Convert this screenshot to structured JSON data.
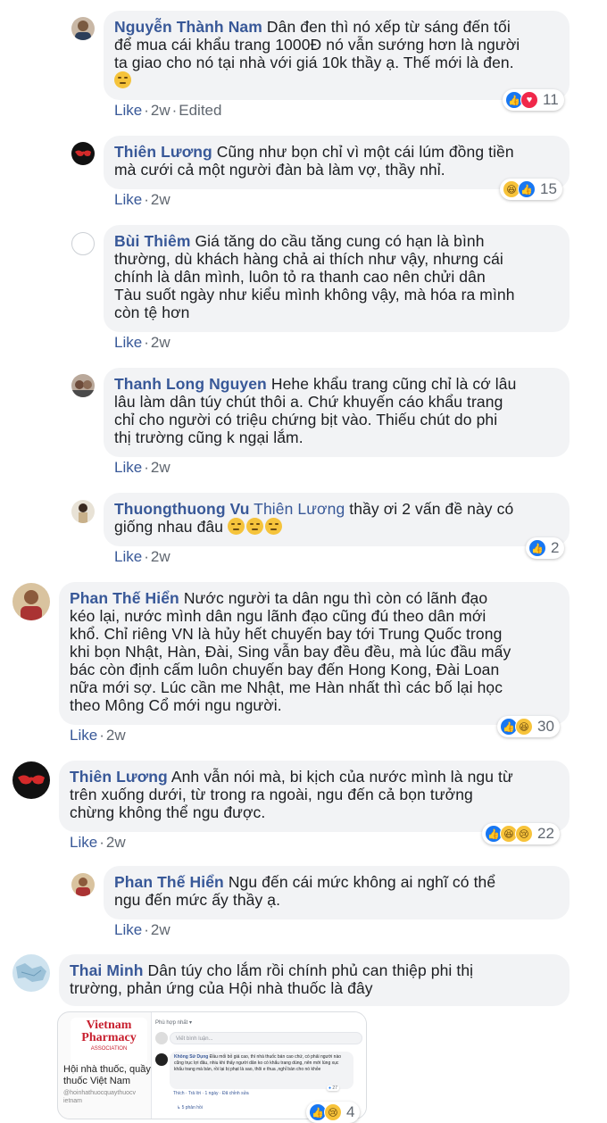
{
  "comments": [
    {
      "name": "Nguyễn Thành Nam",
      "text_lines": [
        "Dân đen thì nó xếp từ sáng đến tối",
        "để mua cái khẩu trang 1000Đ nó vẫn sướng hơn là người",
        "ta giao cho nó tại nhà với giá 10k thầy ạ. Thế mới là đen."
      ],
      "like": "Like",
      "time": "2w",
      "edited": "Edited",
      "reactions": "11"
    },
    {
      "name": "Thiên Lương",
      "text_lines": [
        "Cũng như bọn chỉ vì một cái lúm đồng tiền",
        "mà cưới cả một người đàn bà làm vợ, thầy nhỉ."
      ],
      "like": "Like",
      "time": "2w",
      "reactions": "15"
    },
    {
      "name": "Bùi Thiêm",
      "text_lines": [
        "Giá tăng do cầu tăng cung có hạn là bình",
        "thường, dù khách hàng chả ai thích như vậy, nhưng cái",
        "chính là dân mình, luôn tỏ ra thanh cao nên chửi dân",
        "Tàu suốt ngày như kiểu mình không vậy, mà hóa ra mình",
        "còn tệ hơn"
      ],
      "like": "Like",
      "time": "2w"
    },
    {
      "name": "Thanh Long Nguyen",
      "text_lines": [
        "Hehe khẩu trang cũng chỉ là cớ lâu",
        "lâu làm dân túy chút thôi a. Chứ khuyến cáo khẩu trang",
        "chỉ cho người có triệu chứng bịt vào. Thiếu chút do phi",
        "thị trường cũng k ngại lắm."
      ],
      "like": "Like",
      "time": "2w"
    },
    {
      "name": "Thuongthuong Vu",
      "tag": "Thiên Lương",
      "text_lines": [
        "thầy ơi 2 vấn đề này có",
        "giống nhau đâu"
      ],
      "like": "Like",
      "time": "2w",
      "reactions": "2"
    },
    {
      "name": "Phan Thế Hiển",
      "text_lines": [
        "Nước người ta dân ngu thì còn có lãnh đạo",
        "kéo lại, nước mình dân ngu lãnh đạo cũng đú theo dân mới",
        "khổ. Chỉ riêng VN là hủy hết chuyến bay tới Trung Quốc trong",
        "khi bọn Nhật, Hàn, Đài, Sing vẫn bay đều đều, mà lúc đầu mấy",
        "bác còn định cấm luôn chuyến bay đến Hong Kong, Đài Loan",
        "nữa mới sợ. Lúc cần me Nhật, me Hàn nhất thì các bố lại học",
        "theo Mông Cổ mới ngu người."
      ],
      "like": "Like",
      "time": "2w",
      "reactions": "30"
    },
    {
      "name": "Thiên Lương",
      "text_lines": [
        "Anh vẫn nói mà, bi kịch của nước mình là ngu từ",
        "trên xuống dưới, từ trong ra ngoài, ngu đến cả bọn tưởng",
        "chừng không thể ngu được."
      ],
      "like": "Like",
      "time": "2w",
      "reactions": "22"
    },
    {
      "name": "Phan Thế Hiển",
      "text_lines": [
        "Ngu đến cái mức không ai nghĩ có thể",
        "ngu đến mức ấy thầy ạ."
      ],
      "like": "Like",
      "time": "2w"
    },
    {
      "name": "Thai Minh",
      "text_lines": [
        "Dân túy cho lắm rồi chính phủ can thiệp phi thị",
        "trường, phản ứng của Hội nhà thuốc là đây"
      ],
      "reactions": "4"
    }
  ],
  "attachment": {
    "logo_line1": "Vietnam",
    "logo_line2": "Pharmacy",
    "logo_line3": "ASSOCIATION",
    "org_name_line1": "Hội nhà thuốc, quầy",
    "org_name_line2": "thuốc Việt Nam",
    "handle": "@hoinhathuocquaythuocv ietnam",
    "sort": "Phù hợp nhất ▾",
    "input_placeholder": "Viết bình luận...",
    "inner_name": "Không Sử Dụng",
    "inner_text": "Đầu mối bỏ giá cao, thì nhà thuốc bán cao chứ, có phải người nào cũng trục lợi đâu, nhiu khi thấy người dân ko có khẩu trang dùng, nên mới lùng xục khẩu trang mà bán, rồi lại bị phạt là sao, thôi e thua ,nghỉ bán cho nó khỏe",
    "inner_meta": "Thích · Trả lời · 1 ngày · Đã chỉnh sửa",
    "inner_count": "27",
    "inner_replies": "↳ 5 phản hồi"
  },
  "colors": {
    "link": "#385898",
    "bubble": "#f2f3f5",
    "meta": "#606770",
    "like": "#1877f2",
    "love": "#f0284a",
    "haha": "#f7c33a"
  }
}
